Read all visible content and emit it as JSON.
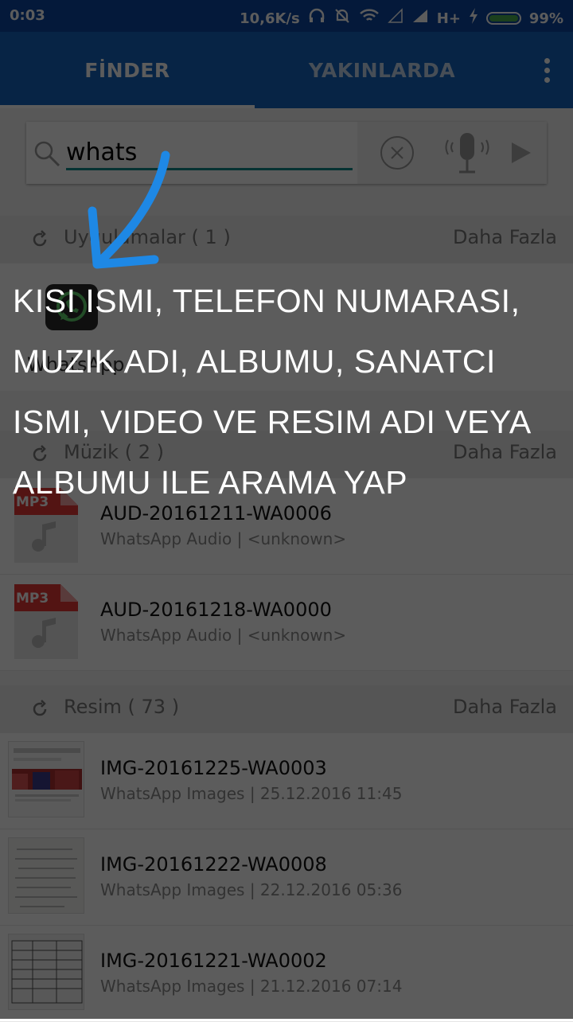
{
  "status": {
    "time": "0:03",
    "speed": "10,6K/s",
    "network": "H+",
    "battery": "99%"
  },
  "tabs": [
    {
      "label": "FİNDER"
    },
    {
      "label": "YAKINLARDA"
    }
  ],
  "search": {
    "value": "whats",
    "placeholder": ""
  },
  "sections": {
    "apps": {
      "title": "Uygulamalar ( 1 )",
      "more": "Daha Fazla"
    },
    "music": {
      "title": "Müzik ( 2 )",
      "more": "Daha Fazla"
    },
    "images": {
      "title": "Resim ( 73 )",
      "more": "Daha Fazla"
    }
  },
  "app": {
    "name": "WhatsApp"
  },
  "music_items": [
    {
      "title": "AUD-20161211-WA0006",
      "subtitle": "WhatsApp Audio | <unknown>",
      "badge": "MP3"
    },
    {
      "title": "AUD-20161218-WA0000",
      "subtitle": "WhatsApp Audio | <unknown>",
      "badge": "MP3"
    }
  ],
  "image_items": [
    {
      "title": "IMG-20161225-WA0003",
      "subtitle": "WhatsApp Images | 25.12.2016 11:45"
    },
    {
      "title": "IMG-20161222-WA0008",
      "subtitle": "WhatsApp Images | 22.12.2016 05:36"
    },
    {
      "title": "IMG-20161221-WA0002",
      "subtitle": "WhatsApp Images | 21.12.2016 07:14"
    }
  ],
  "instruction": {
    "lines": [
      "KISI ISMI, TELEFON NUMARASI,",
      "MUZIK ADI, ALBUMU, SANATCI",
      "ISMI, VIDEO VE RESIM ADI  VEYA",
      "ALBUMU ILE ARAMA YAP"
    ]
  },
  "colors": {
    "statusbar": "#0d47a1",
    "appbar": "#1565c0",
    "accent": "#128c8c",
    "arrow": "#1e88e5",
    "mp3": "#e53935"
  },
  "icons": [
    "search-icon",
    "clear-icon",
    "mic-icon",
    "send-icon",
    "refresh-icon",
    "whatsapp-icon",
    "music-note-icon",
    "overflow-menu-icon",
    "wifi-icon",
    "signal-icon",
    "headset-icon",
    "mute-icon",
    "charging-icon"
  ]
}
